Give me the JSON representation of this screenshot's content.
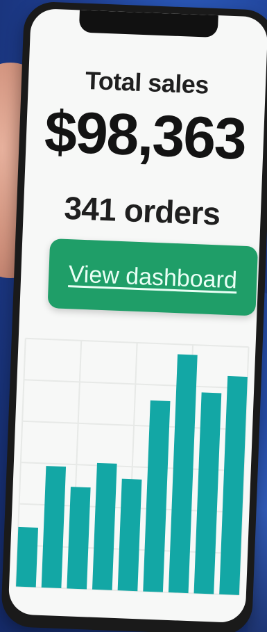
{
  "summary": {
    "title": "Total sales",
    "amount": "$98,363",
    "orders": "341 orders"
  },
  "actions": {
    "view_dashboard": "View dashboard"
  },
  "chart_data": {
    "type": "bar",
    "title": "",
    "xlabel": "",
    "ylabel": "",
    "categories": [],
    "values": [
      0.24,
      0.49,
      0.41,
      0.51,
      0.45,
      0.77,
      0.96,
      0.81,
      0.88
    ],
    "ylim": [
      0,
      1
    ],
    "grid": true,
    "bar_color": "#13a7a5",
    "grid_color": "#e7e9e7"
  },
  "colors": {
    "background": "#2b56b8",
    "phone_frame": "#1a1a1a",
    "screen_bg": "#f7f8f7",
    "cta_bg": "#1f9e68",
    "cta_text": "#e9fff5",
    "text_primary": "#1f1f1f"
  }
}
